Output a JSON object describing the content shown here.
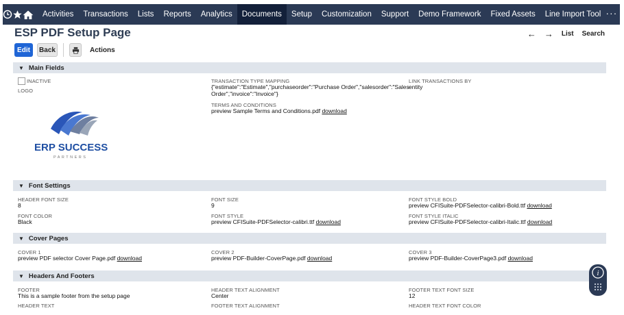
{
  "nav": {
    "items": [
      "Activities",
      "Transactions",
      "Lists",
      "Reports",
      "Analytics",
      "Documents",
      "Setup",
      "Customization",
      "Support",
      "Demo Framework",
      "Fixed Assets",
      "Line Import Tool"
    ],
    "active_index": 5,
    "more": "···"
  },
  "page": {
    "title": "ESP PDF Setup Page"
  },
  "rightnav": {
    "back_arrow": "←",
    "forward_arrow": "→",
    "list": "List",
    "search": "Search"
  },
  "buttons": {
    "edit": "Edit",
    "back": "Back",
    "actions": "Actions"
  },
  "sections": {
    "main": "Main Fields",
    "font": "Font Settings",
    "cover": "Cover Pages",
    "headers": "Headers And Footers"
  },
  "main": {
    "inactive_label": "INACTIVE",
    "logo_label": "LOGO",
    "mapping_label": "TRANSACTION TYPE MAPPING",
    "mapping_value_1": "{\"estimate\":\"Estimate\",\"purchaseorder\":\"Purchase Order\",\"salesorder\":\"Sales",
    "mapping_value_2": "Order\",\"invoice\":\"Invoice\"}",
    "terms_label": "TERMS AND CONDITIONS",
    "terms_value": "preview Sample Terms and Conditions.pdf",
    "link_label": "LINK TRANSACTIONS BY",
    "link_value": "entity",
    "download": "download"
  },
  "logo": {
    "name": "ERP SUCCESS",
    "sub": "PARTNERS"
  },
  "font": {
    "header_size_label": "HEADER FONT SIZE",
    "header_size_value": "8",
    "font_size_label": "FONT SIZE",
    "font_size_value": "9",
    "bold_label": "FONT STYLE BOLD",
    "bold_value": "preview CFISuite-PDFSelector-calibri-Bold.ttf",
    "color_label": "FONT COLOR",
    "color_value": "Black",
    "style_label": "FONT STYLE",
    "style_value": "preview CFISuite-PDFSelector-calibri.ttf",
    "italic_label": "FONT STYLE ITALIC",
    "italic_value": "preview CFISuite-PDFSelector-calibri-Italic.ttf"
  },
  "cover": {
    "c1_label": "COVER 1",
    "c1_value": "preview PDF selector Cover Page.pdf",
    "c2_label": "COVER 2",
    "c2_value": "preview PDF-Builder-CoverPage.pdf",
    "c3_label": "COVER 3",
    "c3_value": "preview PDF-Builder-CoverPage3.pdf"
  },
  "headers": {
    "footer_label": "FOOTER",
    "footer_value": "This is a sample footer from the setup page",
    "hta_label": "HEADER TEXT ALIGNMENT",
    "hta_value": "Center",
    "ftfs_label": "FOOTER TEXT FONT SIZE",
    "ftfs_value": "12",
    "header_text_label": "HEADER TEXT",
    "fta_label": "FOOTER TEXT ALIGNMENT",
    "htfc_label": "HEADER TEXT FONT COLOR"
  },
  "colors": {
    "nav_bg": "#2b3a55",
    "nav_active": "#13203a",
    "edit_button": "#1f65d6",
    "section_bg": "#dfe4eb",
    "logo_text": "#1f4fa3"
  },
  "icons": [
    "recent-icon",
    "star-icon",
    "home-icon",
    "print-icon",
    "chevron-down-icon",
    "info-icon",
    "grid-icon"
  ]
}
